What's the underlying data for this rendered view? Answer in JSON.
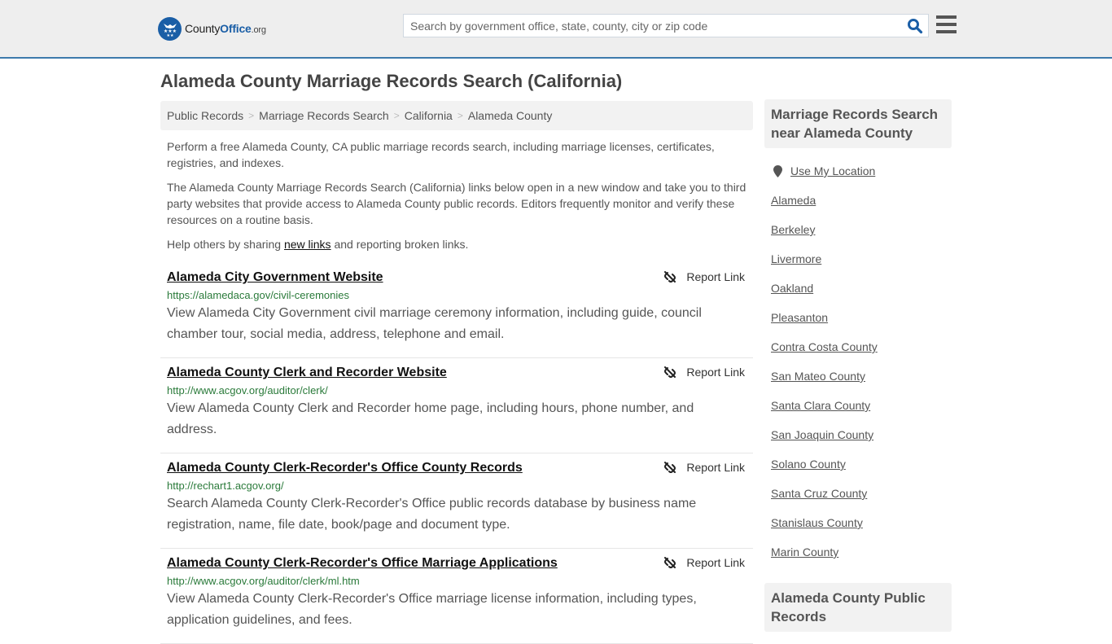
{
  "header": {
    "logo": {
      "county": "County",
      "office": "Office",
      "org": ".org"
    },
    "search": {
      "placeholder": "Search by government office, state, county, city or zip code",
      "value": ""
    },
    "brand_color": "#1a5ea6",
    "accent_border": "#3d7aab"
  },
  "page": {
    "title": "Alameda County Marriage Records Search (California)"
  },
  "breadcrumb": [
    {
      "label": "Public Records"
    },
    {
      "label": "Marriage Records Search"
    },
    {
      "label": "California"
    },
    {
      "label": "Alameda County"
    }
  ],
  "breadcrumb_separator": ">",
  "intro": {
    "p1": "Perform a free Alameda County, CA public marriage records search, including marriage licenses, certificates, registries, and indexes.",
    "p2": "The Alameda County Marriage Records Search (California) links below open in a new window and take you to third party websites that provide access to Alameda County public records. Editors frequently monitor and verify these resources on a routine basis.",
    "p3_before": "Help others by sharing ",
    "p3_link": "new links",
    "p3_after": " and reporting broken links."
  },
  "results": [
    {
      "title": "Alameda City Government Website",
      "url": "https://alamedaca.gov/civil-ceremonies",
      "description": "View Alameda City Government civil marriage ceremony information, including guide, council chamber tour, social media, address, telephone and email.",
      "report_label": "Report Link"
    },
    {
      "title": "Alameda County Clerk and Recorder Website",
      "url": "http://www.acgov.org/auditor/clerk/",
      "description": "View Alameda County Clerk and Recorder home page, including hours, phone number, and address.",
      "report_label": "Report Link"
    },
    {
      "title": "Alameda County Clerk-Recorder's Office County Records",
      "url": "http://rechart1.acgov.org/",
      "description": "Search Alameda County Clerk-Recorder's Office public records database by business name registration, name, file date, book/page and document type.",
      "report_label": "Report Link"
    },
    {
      "title": "Alameda County Clerk-Recorder's Office Marriage Applications",
      "url": "http://www.acgov.org/auditor/clerk/ml.htm",
      "description": "View Alameda County Clerk-Recorder's Office marriage license information, including types, application guidelines, and fees.",
      "report_label": "Report Link"
    }
  ],
  "sidebar": {
    "nearby_heading": "Marriage Records Search near Alameda County",
    "use_location": "Use My Location",
    "nearby": [
      {
        "label": "Alameda"
      },
      {
        "label": "Berkeley"
      },
      {
        "label": "Livermore"
      },
      {
        "label": "Oakland"
      },
      {
        "label": "Pleasanton"
      },
      {
        "label": "Contra Costa County"
      },
      {
        "label": "San Mateo County"
      },
      {
        "label": "Santa Clara County"
      },
      {
        "label": "San Joaquin County"
      },
      {
        "label": "Solano County"
      },
      {
        "label": "Santa Cruz County"
      },
      {
        "label": "Stanislaus County"
      },
      {
        "label": "Marin County"
      }
    ],
    "second_heading": "Alameda County Public Records"
  }
}
